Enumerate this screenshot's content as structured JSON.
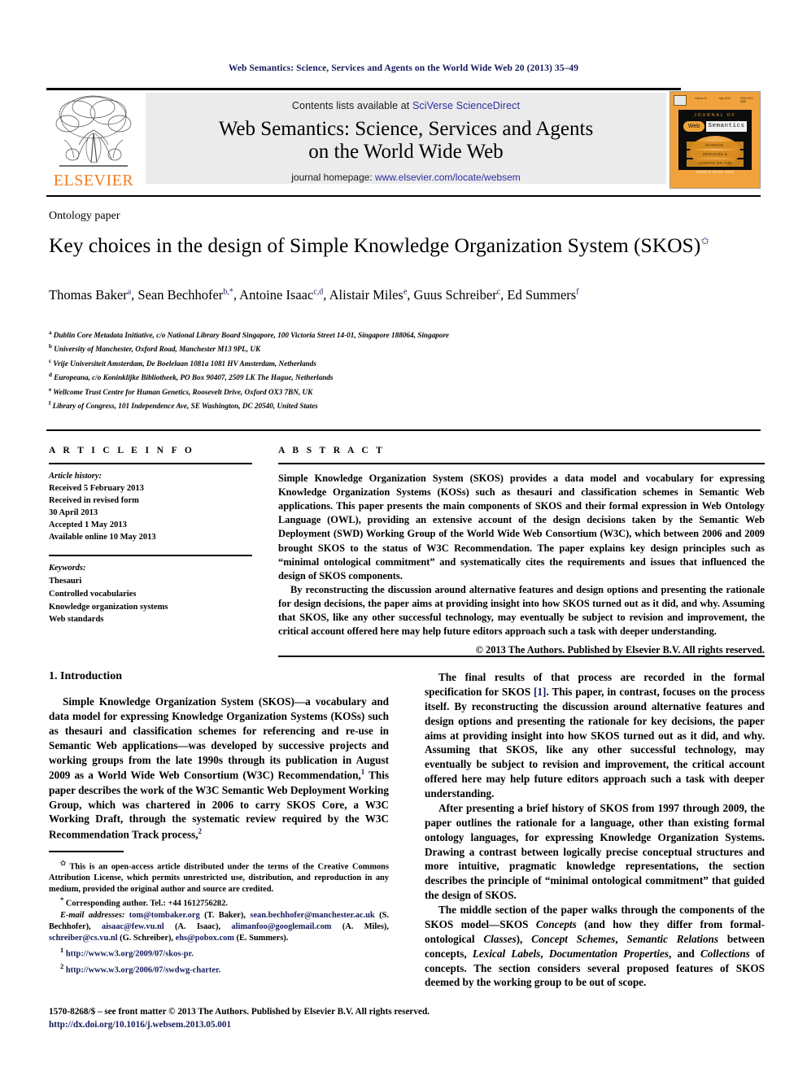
{
  "running_head": "Web Semantics: Science, Services and Agents on the World Wide Web 20 (2013) 35–49",
  "banner": {
    "contents_prefix": "Contents lists available at ",
    "contents_link": "SciVerse ScienceDirect",
    "journal_title_line1": "Web Semantics: Science, Services and Agents",
    "journal_title_line2": "on the World Wide Web",
    "homepage_prefix": "journal homepage: ",
    "homepage_link": "www.elsevier.com/locate/websem",
    "publisher": "ELSEVIER",
    "cover": {
      "journal_of": "JOURNAL OF",
      "web": "Web",
      "semantics": "Semantics",
      "band1": "SCIENCE,",
      "band2": "SERVICES &",
      "band3": "AGENTS ON THE",
      "band4": "WORLD WIDE WEB",
      "top_left": "ISSN\n1570-8268",
      "top_mid1": "Volume 20",
      "top_mid2": "May 2013",
      "top_mid3": "ISSN 1570-8268"
    },
    "accent_orange": "#f07d22",
    "link_blue": "#2b2f9e"
  },
  "article": {
    "type": "Ontology paper",
    "title": "Key choices in the design of Simple Knowledge Organization System (SKOS)",
    "title_star": "✩",
    "authors_line1_pre": "Thomas Baker",
    "authors": [
      {
        "name": "Thomas Baker",
        "sup": "a"
      },
      {
        "name": "Sean Bechhofer",
        "sup": "b,*"
      },
      {
        "name": "Antoine Isaac",
        "sup": "c,d"
      },
      {
        "name": "Alistair Miles",
        "sup": "e"
      },
      {
        "name": "Guus Schreiber",
        "sup": "c"
      },
      {
        "name": "Ed Summers",
        "sup": "f"
      }
    ],
    "affiliations": [
      {
        "mark": "a",
        "text": "Dublin Core Metadata Initiative, c/o National Library Board Singapore, 100 Victoria Street 14-01, Singapore 188064, Singapore"
      },
      {
        "mark": "b",
        "text": "University of Manchester, Oxford Road, Manchester M13 9PL, UK"
      },
      {
        "mark": "c",
        "text": "Vrije Universiteit Amsterdam, De Boelelaan 1081a 1081 HV Amsterdam, Netherlands"
      },
      {
        "mark": "d",
        "text": "Europeana, c/o Koninklijke Bibliotheek, PO Box 90407, 2509 LK The Hague, Netherlands"
      },
      {
        "mark": "e",
        "text": "Wellcome Trust Centre for Human Genetics, Roosevelt Drive, Oxford OX3 7BN, UK"
      },
      {
        "mark": "f",
        "text": "Library of Congress, 101 Independence Ave, SE Washington, DC 20540, United States"
      }
    ]
  },
  "info": {
    "heading": "A R T I C L E   I N F O",
    "history_label": "Article history:",
    "history": [
      "Received 5 February 2013",
      "Received in revised form",
      "30 April 2013",
      "Accepted 1 May 2013",
      "Available online 10 May 2013"
    ],
    "keywords_label": "Keywords:",
    "keywords": [
      "Thesauri",
      "Controlled vocabularies",
      "Knowledge organization systems",
      "Web standards"
    ]
  },
  "abstract": {
    "heading": "A B S T R A C T",
    "paragraph1": "Simple Knowledge Organization System (SKOS) provides a data model and vocabulary for expressing Knowledge Organization Systems (KOSs) such as thesauri and classification schemes in Semantic Web applications. This paper presents the main components of SKOS and their formal expression in Web Ontology Language (OWL), providing an extensive account of the design decisions taken by the Semantic Web Deployment (SWD) Working Group of the World Wide Web Consortium (W3C), which between 2006 and 2009 brought SKOS to the status of W3C Recommendation. The paper explains key design principles such as “minimal ontological commitment” and systematically cites the requirements and issues that influenced the design of SKOS components.",
    "paragraph2": "By reconstructing the discussion around alternative features and design options and presenting the rationale for design decisions, the paper aims at providing insight into how SKOS turned out as it did, and why. Assuming that SKOS, like any other successful technology, may eventually be subject to revision and improvement, the critical account offered here may help future editors approach such a task with deeper understanding.",
    "copyright": "© 2013 The Authors. Published by Elsevier B.V. All rights reserved."
  },
  "body": {
    "section_heading": "1. Introduction",
    "left_p1": "Simple Knowledge Organization System (SKOS)—a vocabulary and data model for expressing Knowledge Organization Systems (KOSs) such as thesauri and classification schemes for referencing and re-use in Semantic Web applications—was developed by successive projects and working groups from the late 1990s through its publication in August 2009 as a World Wide Web Consortium (W3C) Recommendation,",
    "left_p1_sup": "1",
    "left_p1_cont": " This paper describes the work of the W3C Semantic Web Deployment Working Group, which was chartered in 2006 to carry SKOS Core, a W3C Working Draft, through the systematic review required by the W3C Recommendation Track process,",
    "left_p1_sup2": "2",
    "right_p1_a": "The final results of that process are recorded in the formal specification for SKOS ",
    "right_p1_ref": "[1]",
    "right_p1_b": ". This paper, in contrast, focuses on the process itself. By reconstructing the discussion around alternative features and design options and presenting the rationale for key decisions, the paper aims at providing insight into how SKOS turned out as it did, and why. Assuming that SKOS, like any other successful technology, may eventually be subject to revision and improvement, the critical account offered here may help future editors approach such a task with deeper understanding.",
    "right_p2": "After presenting a brief history of SKOS from 1997 through 2009, the paper outlines the rationale for a language, other than existing formal ontology languages, for expressing Knowledge Organization Systems. Drawing a contrast between logically precise conceptual structures and more intuitive, pragmatic knowledge representations, the section describes the principle of “minimal ontological commitment” that guided the design of SKOS.",
    "right_p3_a": "The middle section of the paper walks through the components of the SKOS model—SKOS ",
    "right_p3_i1": "Concepts",
    "right_p3_b": " (and how they differ from formal-ontological ",
    "right_p3_i2": "Classes",
    "right_p3_c": "), ",
    "right_p3_i3": "Concept Schemes",
    "right_p3_d": ", ",
    "right_p3_i4": "Semantic Relations",
    "right_p3_e": " between concepts, ",
    "right_p3_i5": "Lexical Labels",
    "right_p3_f": ", ",
    "right_p3_i6": "Documentation Properties",
    "right_p3_g": ", and ",
    "right_p3_i7": "Collections",
    "right_p3_h": " of concepts. The section considers several proposed features of SKOS deemed by the working group to be out of scope."
  },
  "footnotes": {
    "star_mark": "✩",
    "star_text": "This is an open-access article distributed under the terms of the Creative Commons Attribution License, which permits unrestricted use, distribution, and reproduction in any medium, provided the original author and source are credited.",
    "corr_mark": "*",
    "corr_text": "Corresponding author. Tel.: +44 1612756282.",
    "email_label": "E-mail addresses:",
    "emails": [
      {
        "addr": "tom@tombaker.org",
        "who": " (T. Baker),"
      },
      {
        "addr": "sean.bechhofer@manchester.ac.uk",
        "who": " (S. Bechhofer),"
      },
      {
        "addr": "aisaac@few.vu.nl",
        "who": " (A. Isaac),"
      },
      {
        "addr": "alimanfoo@googlemail.com",
        "who": " (A. Miles),"
      },
      {
        "addr": "schreiber@cs.vu.nl",
        "who": " (G. Schreiber),"
      },
      {
        "addr": "ehs@pobox.com",
        "who": " (E. Summers)."
      }
    ],
    "note1_mark": "1",
    "note1": "http://www.w3.org/2009/07/skos-pr.",
    "note2_mark": "2",
    "note2": "http://www.w3.org/2006/07/swdwg-charter."
  },
  "page_footer": {
    "line1": "1570-8268/$ – see front matter © 2013 The Authors. Published by Elsevier B.V. All rights reserved.",
    "doi": "http://dx.doi.org/10.1016/j.websem.2013.05.001"
  }
}
